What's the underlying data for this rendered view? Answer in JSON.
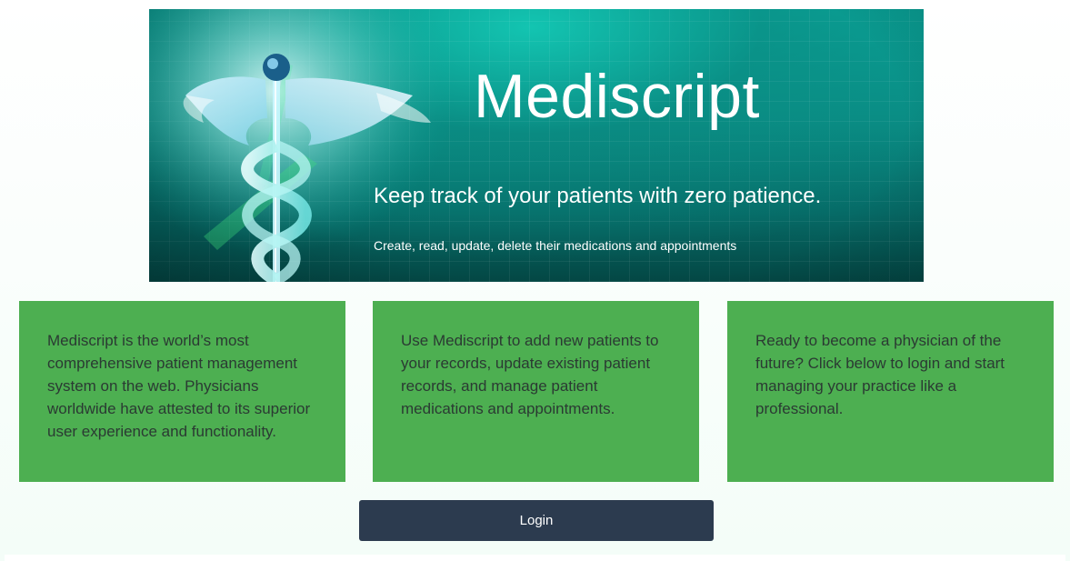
{
  "banner": {
    "title": "Mediscript",
    "tagline": "Keep track of your patients with zero patience.",
    "subtext": "Create, read, update, delete their medications and appointments",
    "image_icon": "caduceus-icon",
    "colors": {
      "teal_light": "#0ac4b0",
      "teal_dark": "#044744"
    }
  },
  "cards": [
    {
      "text": "Mediscript is the world’s most comprehensive patient management system on the web. Physicians worldwide have attested to its superior user experience and functionality."
    },
    {
      "text": "Use Mediscript to add new patients to your records, update existing patient records, and manage patient medications and appointments."
    },
    {
      "text": "Ready to become a physician of the future? Click below to login and start managing your practice like a professional."
    }
  ],
  "login": {
    "label": "Login"
  },
  "colors": {
    "card_bg": "#4daf51",
    "card_text": "#2b3a33",
    "button_bg": "#2c3b4f",
    "page_bg": "#f4fdf8"
  }
}
